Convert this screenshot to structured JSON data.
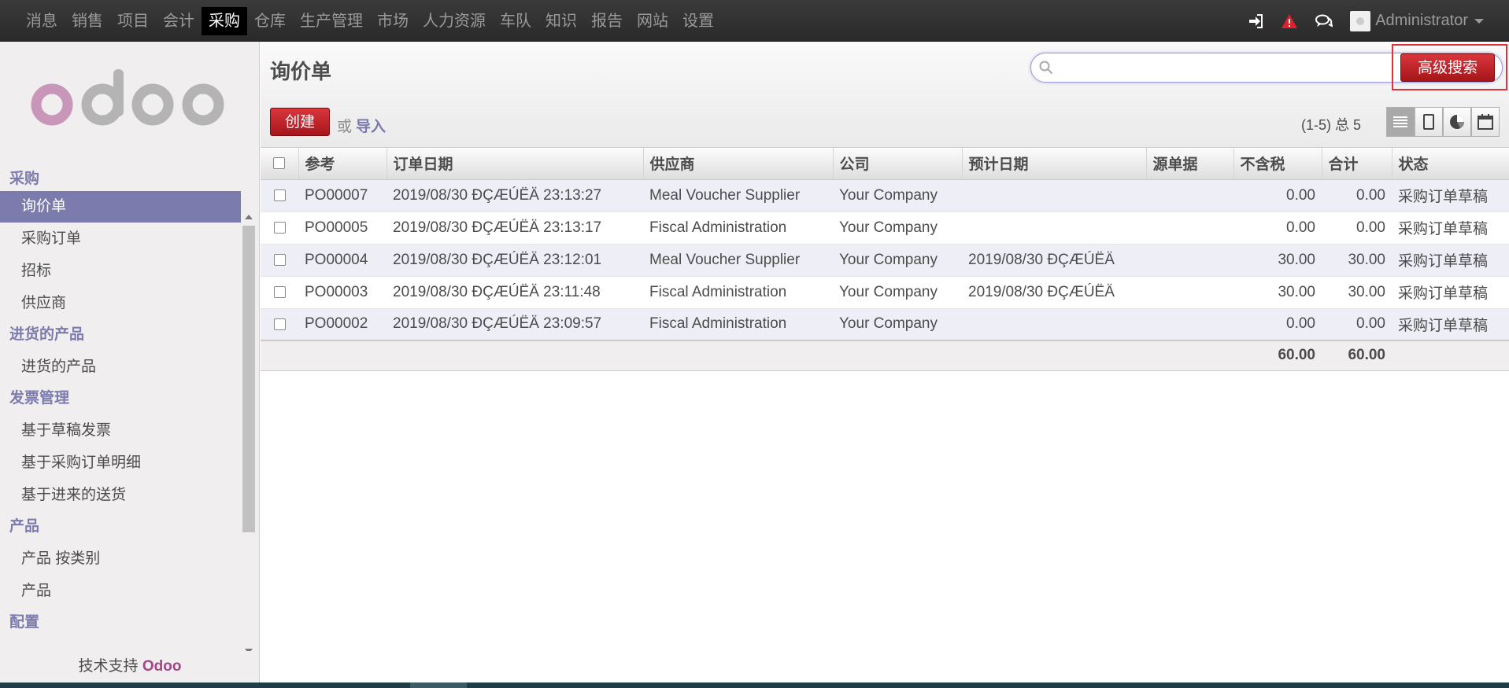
{
  "topbar": {
    "menu": [
      "消息",
      "销售",
      "项目",
      "会计",
      "采购",
      "仓库",
      "生产管理",
      "市场",
      "人力资源",
      "车队",
      "知识",
      "报告",
      "网站",
      "设置"
    ],
    "active_index": 4,
    "user": "Administrator"
  },
  "sidebar": {
    "sections": [
      {
        "title": "采购",
        "items": [
          "询价单",
          "采购订单",
          "招标",
          "供应商"
        ]
      },
      {
        "title": "进货的产品",
        "items": [
          "进货的产品"
        ]
      },
      {
        "title": "发票管理",
        "items": [
          "基于草稿发票",
          "基于采购订单明细",
          "基于进来的送货"
        ]
      },
      {
        "title": "产品",
        "items": [
          "产品 按类别",
          "产品"
        ]
      },
      {
        "title": "配置",
        "items": []
      }
    ],
    "active_item": "询价单",
    "powered_prefix": "技术支持",
    "powered_brand": "Odoo"
  },
  "main": {
    "title": "询价单",
    "search_value": "",
    "advanced_search_label": "高级搜索",
    "create_label": "创建",
    "or_label": "或",
    "import_label": "导入",
    "pager": "(1-5) 总 5"
  },
  "table": {
    "columns": [
      "参考",
      "订单日期",
      "供应商",
      "公司",
      "预计日期",
      "源单据",
      "不含税",
      "合计",
      "状态"
    ],
    "rows": [
      [
        "PO00007",
        "2019/08/30 ĐÇÆÚËÄ 23:13:27",
        "Meal Voucher Supplier",
        "Your Company",
        "",
        "",
        "0.00",
        "0.00",
        "采购订单草稿"
      ],
      [
        "PO00005",
        "2019/08/30 ĐÇÆÚËÄ 23:13:17",
        "Fiscal Administration",
        "Your Company",
        "",
        "",
        "0.00",
        "0.00",
        "采购订单草稿"
      ],
      [
        "PO00004",
        "2019/08/30 ĐÇÆÚËÄ 23:12:01",
        "Meal Voucher Supplier",
        "Your Company",
        "2019/08/30 ĐÇÆÚËÄ",
        "",
        "30.00",
        "30.00",
        "采购订单草稿"
      ],
      [
        "PO00003",
        "2019/08/30 ĐÇÆÚËÄ 23:11:48",
        "Fiscal Administration",
        "Your Company",
        "2019/08/30 ĐÇÆÚËÄ",
        "",
        "30.00",
        "30.00",
        "采购订单草稿"
      ],
      [
        "PO00002",
        "2019/08/30 ĐÇÆÚËÄ 23:09:57",
        "Fiscal Administration",
        "Your Company",
        "",
        "",
        "0.00",
        "0.00",
        "采购订单草稿"
      ]
    ],
    "totals": {
      "untaxed": "60.00",
      "total": "60.00"
    }
  },
  "colors": {
    "accent": "#7c7bad",
    "primary_button": "#c1272d",
    "brand": "#a24689"
  }
}
